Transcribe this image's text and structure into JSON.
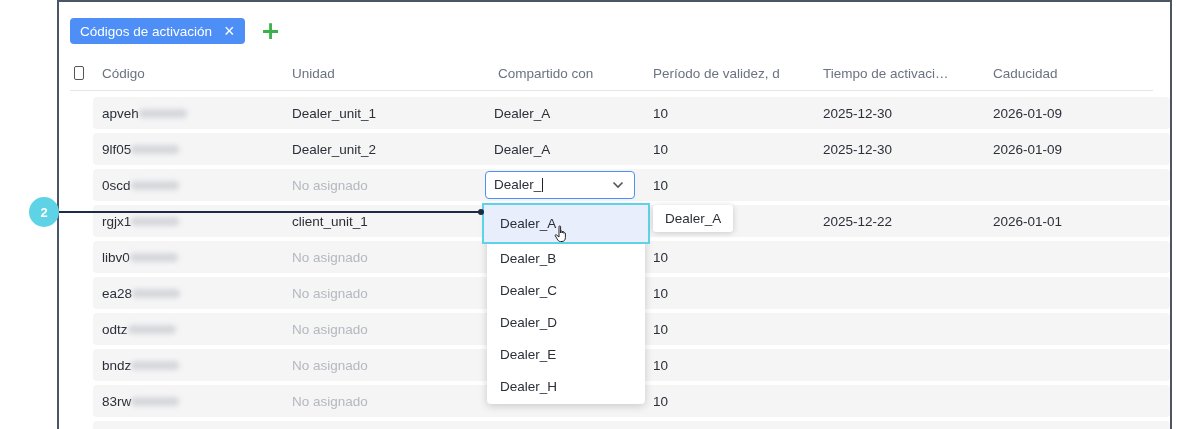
{
  "tabs": [
    {
      "label": "Códigos de activación",
      "selected": true,
      "close": "×"
    }
  ],
  "add_tab": "+",
  "table": {
    "columns": [
      "Código",
      "Unidad",
      "Compartido con",
      "Período de validez, d",
      "Tiempo de activaci…",
      "Caducidad"
    ],
    "select_all": {
      "checked": false
    },
    "rows": [
      {
        "code": "apveh",
        "unit": "Dealer_unit_1",
        "unit_assigned": true,
        "shared": "Dealer_A",
        "period": "10",
        "activation": "2025-12-30",
        "expiry": "2026-01-09"
      },
      {
        "code": "9lf05",
        "unit": "Dealer_unit_2",
        "unit_assigned": true,
        "shared": "Dealer_A",
        "period": "10",
        "activation": "2025-12-30",
        "expiry": "2026-01-09"
      },
      {
        "code": "0scd",
        "unit": "No asignado",
        "unit_assigned": false,
        "shared_field": {
          "value": "Dealer_"
        },
        "period": "10"
      },
      {
        "code": "rgjx1",
        "unit": "client_unit_1",
        "unit_assigned": true,
        "activation": "2025-12-22",
        "expiry": "2026-01-01"
      },
      {
        "code": "libv0",
        "unit": "No asignado",
        "unit_assigned": false,
        "period": "10"
      },
      {
        "code": "ea28",
        "unit": "No asignado",
        "unit_assigned": false,
        "period": "10"
      },
      {
        "code": "odtz",
        "unit": "No asignado",
        "unit_assigned": false,
        "period": "10"
      },
      {
        "code": "bndz",
        "unit": "No asignado",
        "unit_assigned": false,
        "period": "10"
      },
      {
        "code": "83rw",
        "unit": "No asignado",
        "unit_assigned": false,
        "period": "10"
      },
      {}
    ]
  },
  "dropdown": {
    "options": [
      {
        "label": "Dealer_A",
        "selected": true
      },
      {
        "label": "Dealer_B",
        "selected": false
      },
      {
        "label": "Dealer_C",
        "selected": false
      },
      {
        "label": "Dealer_D",
        "selected": false
      },
      {
        "label": "Dealer_E",
        "selected": false
      },
      {
        "label": "Dealer_H",
        "selected": false
      }
    ],
    "tooltip": "Dealer_A"
  },
  "callout": {
    "label": "2"
  }
}
